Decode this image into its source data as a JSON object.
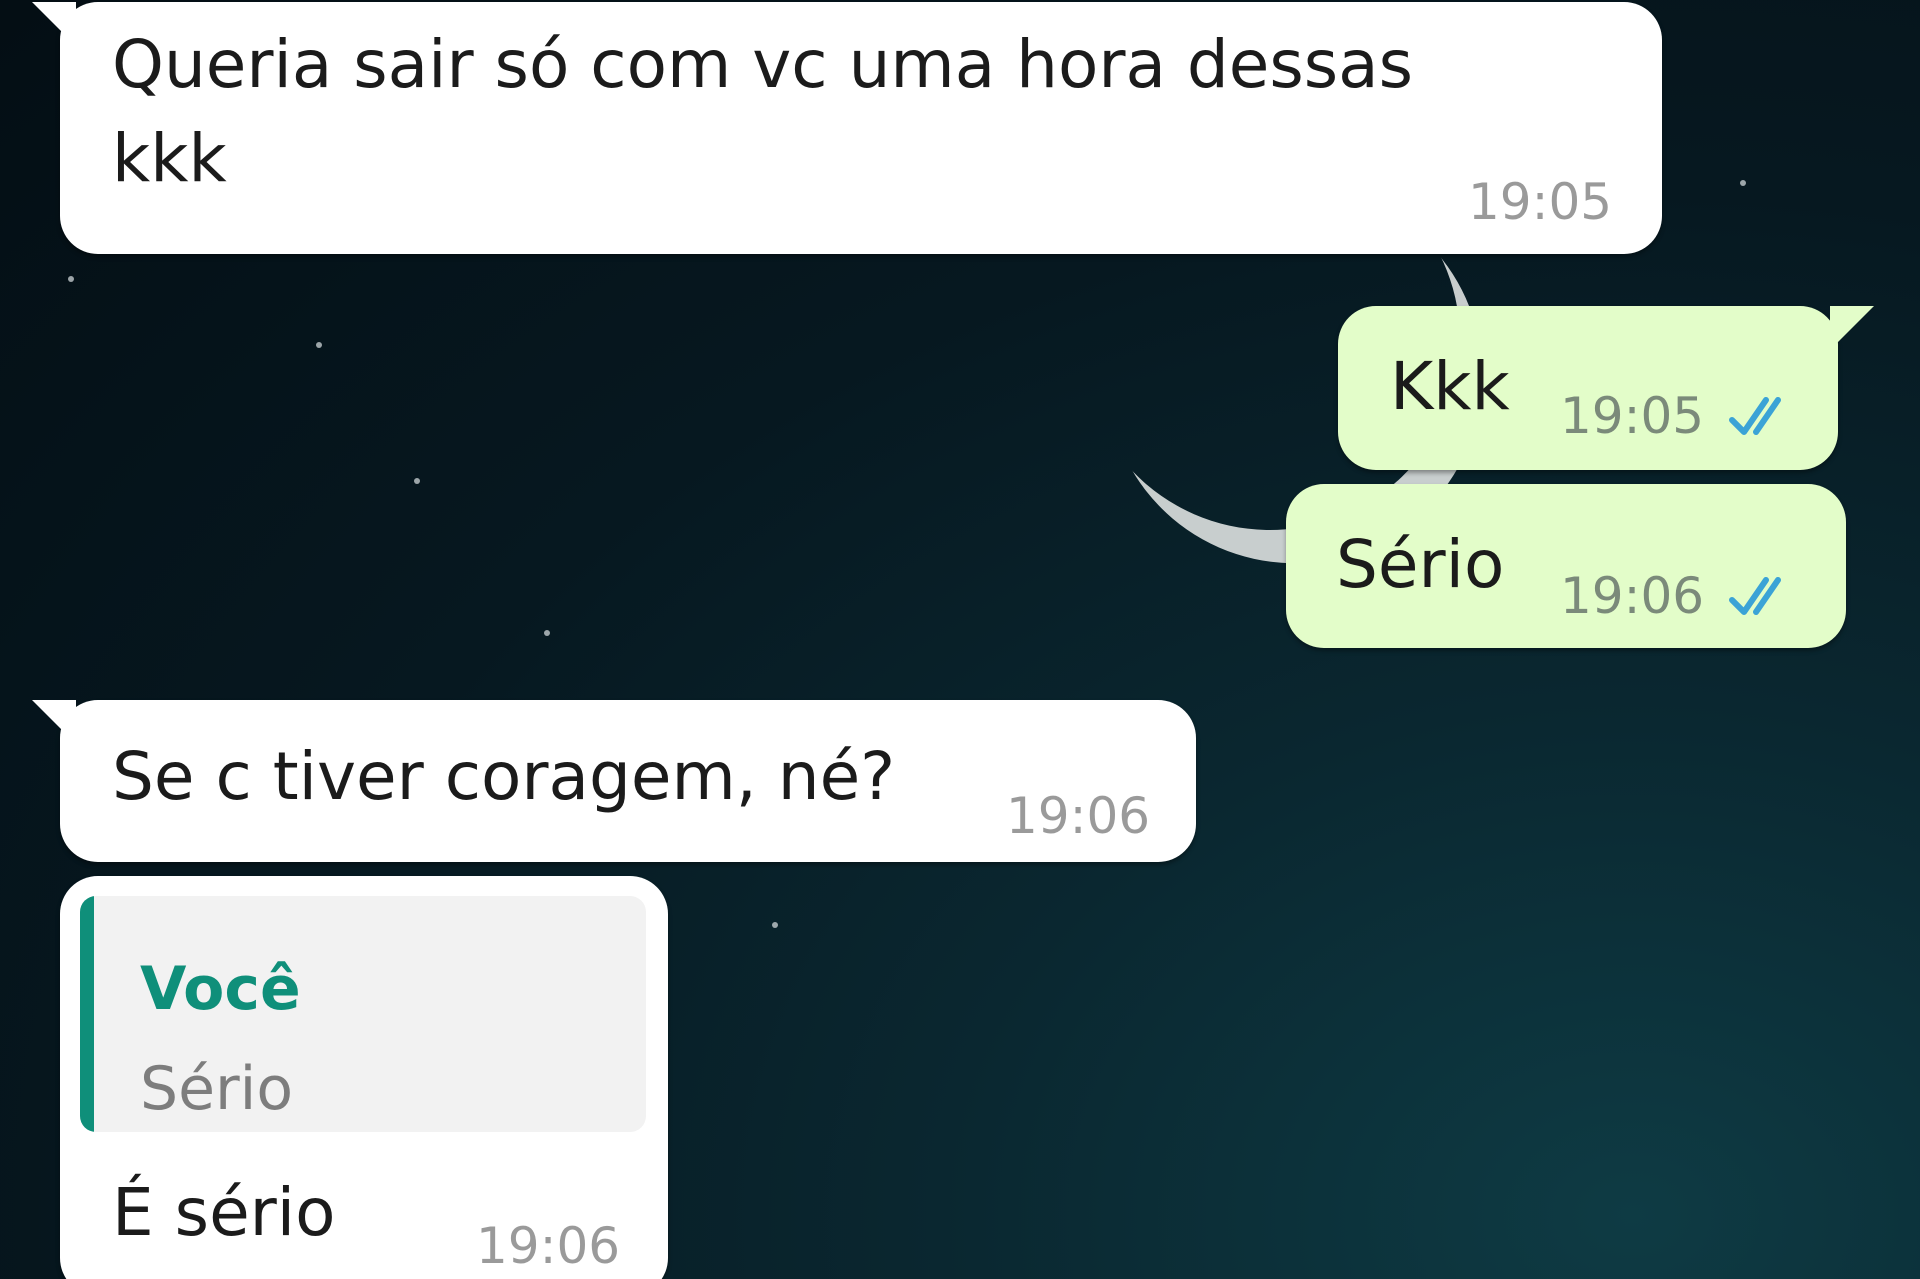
{
  "colors": {
    "incoming_bubble": "#ffffff",
    "outgoing_bubble": "#e3fdc9",
    "quote_accent": "#0f8f7a",
    "read_ticks": "#3ba3d6"
  },
  "messages": [
    {
      "direction": "incoming",
      "text": "Queria sair só com vc uma hora dessas\nkkk",
      "time": "19:05"
    },
    {
      "direction": "outgoing",
      "text": "Kkk",
      "time": "19:05",
      "status_icon": "double-check-read-icon"
    },
    {
      "direction": "outgoing",
      "text": "Sério",
      "time": "19:06",
      "status_icon": "double-check-read-icon"
    },
    {
      "direction": "incoming",
      "text": "Se c tiver coragem, né?",
      "time": "19:06"
    },
    {
      "direction": "incoming",
      "quoted": {
        "author": "Você",
        "text": "Sério"
      },
      "text": "É sério",
      "time": "19:06"
    }
  ]
}
